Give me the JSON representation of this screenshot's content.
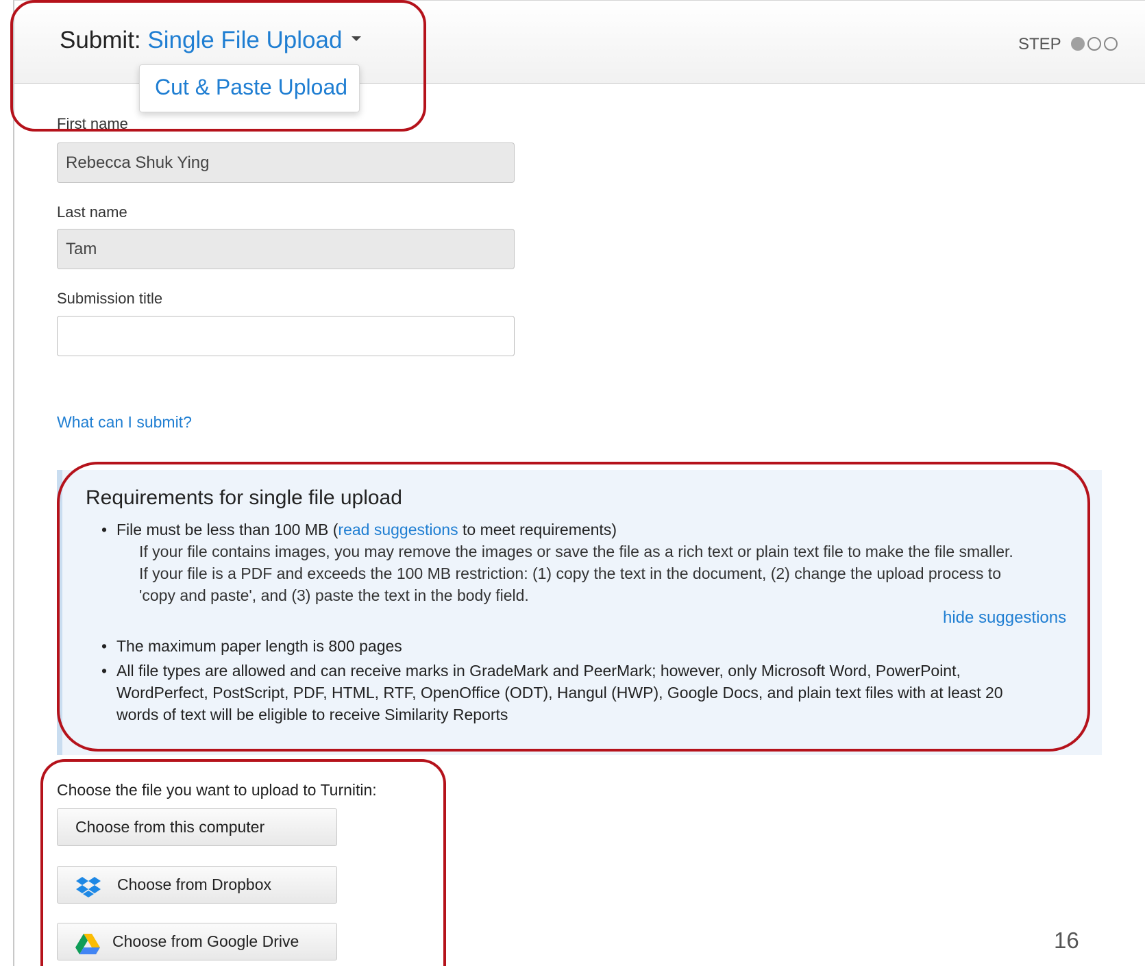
{
  "header": {
    "prefix": "Submit:",
    "mode": "Single File Upload",
    "step_label": "STEP",
    "step_total": 3,
    "step_current": 1
  },
  "dropdown": {
    "option": "Cut & Paste Upload"
  },
  "form": {
    "first_name_label": "First name",
    "first_name_value": "Rebecca Shuk Ying",
    "last_name_label": "Last name",
    "last_name_value": "Tam",
    "title_label": "Submission title",
    "title_value": ""
  },
  "help_link": "What can I submit?",
  "requirements": {
    "heading": "Requirements for single file upload",
    "item1_pre": "File must be less than 100 MB (",
    "item1_link": "read suggestions",
    "item1_post": " to meet requirements)",
    "suggestion_text": "If your file contains images, you may remove the images or save the file as a rich text or plain text file to make the file smaller. If your file is a PDF and exceeds the 100 MB restriction: (1) copy the text in the document, (2) change the upload process to 'copy and paste', and (3) paste the text in the body field.",
    "hide_link": "hide suggestions",
    "item2": "The maximum paper length is 800 pages",
    "item3": "All file types are allowed and can receive marks in GradeMark and PeerMark; however, only Microsoft Word, PowerPoint, WordPerfect, PostScript, PDF, HTML, RTF, OpenOffice (ODT), Hangul (HWP), Google Docs, and plain text files with at least 20 words of text will be eligible to receive Similarity Reports"
  },
  "upload": {
    "label": "Choose the file you want to upload to Turnitin:",
    "computer": "Choose from this computer",
    "dropbox": "Choose from Dropbox",
    "gdrive": "Choose from Google Drive"
  },
  "icons": {
    "dropdown": "chevron-down-icon",
    "dropbox": "dropbox-icon",
    "gdrive": "google-drive-icon"
  },
  "colors": {
    "link": "#1f7ed2",
    "highlight": "#b5121b",
    "requirements_bg": "#eef4fb"
  },
  "page_number": "16"
}
